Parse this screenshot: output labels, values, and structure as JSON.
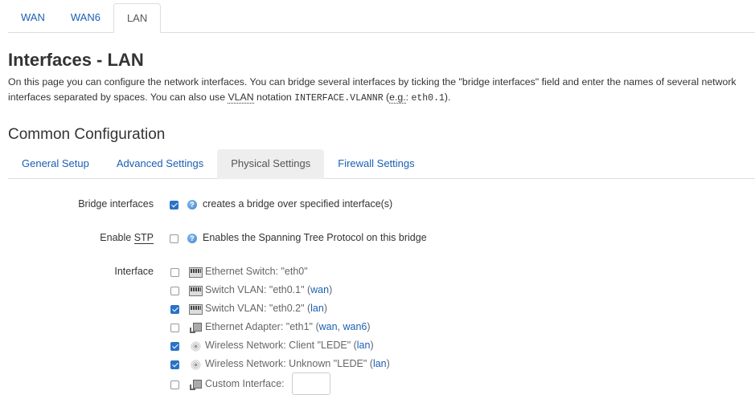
{
  "top_tabs": [
    {
      "label": "WAN",
      "active": false
    },
    {
      "label": "WAN6",
      "active": false
    },
    {
      "label": "LAN",
      "active": true
    }
  ],
  "page": {
    "title": "Interfaces - LAN",
    "description_part1": "On this page you can configure the network interfaces. You can bridge several interfaces by ticking the \"bridge interfaces\" field and enter the names of several network interfaces separated by spaces. You can also use ",
    "description_vlan": "VLAN",
    "description_part2": " notation ",
    "description_code": "INTERFACE.VLANNR",
    "description_part3": " (",
    "description_eg": "e.g.",
    "description_part4": ": ",
    "description_code2": "eth0.1",
    "description_part5": ")."
  },
  "section": {
    "title": "Common Configuration",
    "tabs": [
      {
        "label": "General Setup",
        "active": false
      },
      {
        "label": "Advanced Settings",
        "active": false
      },
      {
        "label": "Physical Settings",
        "active": true
      },
      {
        "label": "Firewall Settings",
        "active": false
      }
    ]
  },
  "bridge": {
    "label": "Bridge interfaces",
    "checked": true,
    "help": "creates a bridge over specified interface(s)"
  },
  "stp": {
    "label_prefix": "Enable ",
    "label_abbr": "STP",
    "checked": false,
    "help": "Enables the Spanning Tree Protocol on this bridge"
  },
  "interface": {
    "label": "Interface",
    "items": [
      {
        "checked": false,
        "icon": "switch-icon",
        "text": "Ethernet Switch: \"eth0\"",
        "links": []
      },
      {
        "checked": false,
        "icon": "switch-icon",
        "text": "Switch VLAN: \"eth0.1\" (",
        "links": [
          "wan"
        ],
        "suffix": ")"
      },
      {
        "checked": true,
        "icon": "switch-icon",
        "text": "Switch VLAN: \"eth0.2\" (",
        "links": [
          "lan"
        ],
        "suffix": ")"
      },
      {
        "checked": false,
        "icon": "ethernet-adapter-icon",
        "text": "Ethernet Adapter: \"eth1\" (",
        "links": [
          "wan",
          "wan6"
        ],
        "suffix": ")"
      },
      {
        "checked": true,
        "icon": "wireless-icon",
        "text": "Wireless Network: Client \"LEDE\" (",
        "links": [
          "lan"
        ],
        "suffix": ")"
      },
      {
        "checked": true,
        "icon": "wireless-icon",
        "text": "Wireless Network: Unknown \"LEDE\" (",
        "links": [
          "lan"
        ],
        "suffix": ")"
      }
    ],
    "custom": {
      "checked": false,
      "icon": "ethernet-adapter-icon",
      "label": "Custom Interface:",
      "value": ""
    }
  }
}
